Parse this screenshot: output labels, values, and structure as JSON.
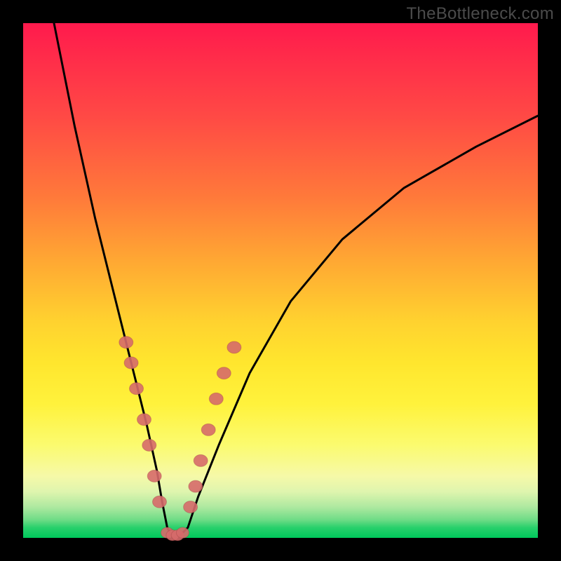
{
  "watermark": "TheBottleneck.com",
  "chart_data": {
    "type": "line",
    "title": "",
    "xlabel": "",
    "ylabel": "",
    "xlim": [
      0,
      100
    ],
    "ylim": [
      0,
      100
    ],
    "series": [
      {
        "name": "curve",
        "x": [
          6,
          10,
          14,
          18,
          22,
          24,
          26,
          27,
          28,
          29,
          30,
          32,
          34,
          38,
          44,
          52,
          62,
          74,
          88,
          100
        ],
        "y": [
          100,
          80,
          62,
          46,
          30,
          22,
          13,
          7,
          2,
          0,
          0,
          2,
          8,
          18,
          32,
          46,
          58,
          68,
          76,
          82
        ]
      }
    ],
    "markers": {
      "left_branch": [
        {
          "x": 20,
          "y": 38
        },
        {
          "x": 21,
          "y": 34
        },
        {
          "x": 22,
          "y": 29
        },
        {
          "x": 23.5,
          "y": 23
        },
        {
          "x": 24.5,
          "y": 18
        },
        {
          "x": 25.5,
          "y": 12
        },
        {
          "x": 26.5,
          "y": 7
        }
      ],
      "valley": [
        {
          "x": 28,
          "y": 1
        },
        {
          "x": 29,
          "y": 0.5
        },
        {
          "x": 30,
          "y": 0.5
        },
        {
          "x": 31,
          "y": 1
        }
      ],
      "right_branch": [
        {
          "x": 32.5,
          "y": 6
        },
        {
          "x": 33.5,
          "y": 10
        },
        {
          "x": 34.5,
          "y": 15
        },
        {
          "x": 36,
          "y": 21
        },
        {
          "x": 37.5,
          "y": 27
        },
        {
          "x": 39,
          "y": 32
        },
        {
          "x": 41,
          "y": 37
        }
      ]
    },
    "colors": {
      "curve": "#000000",
      "marker_fill": "#d66a6a",
      "marker_stroke": "#9a3e3e"
    }
  }
}
